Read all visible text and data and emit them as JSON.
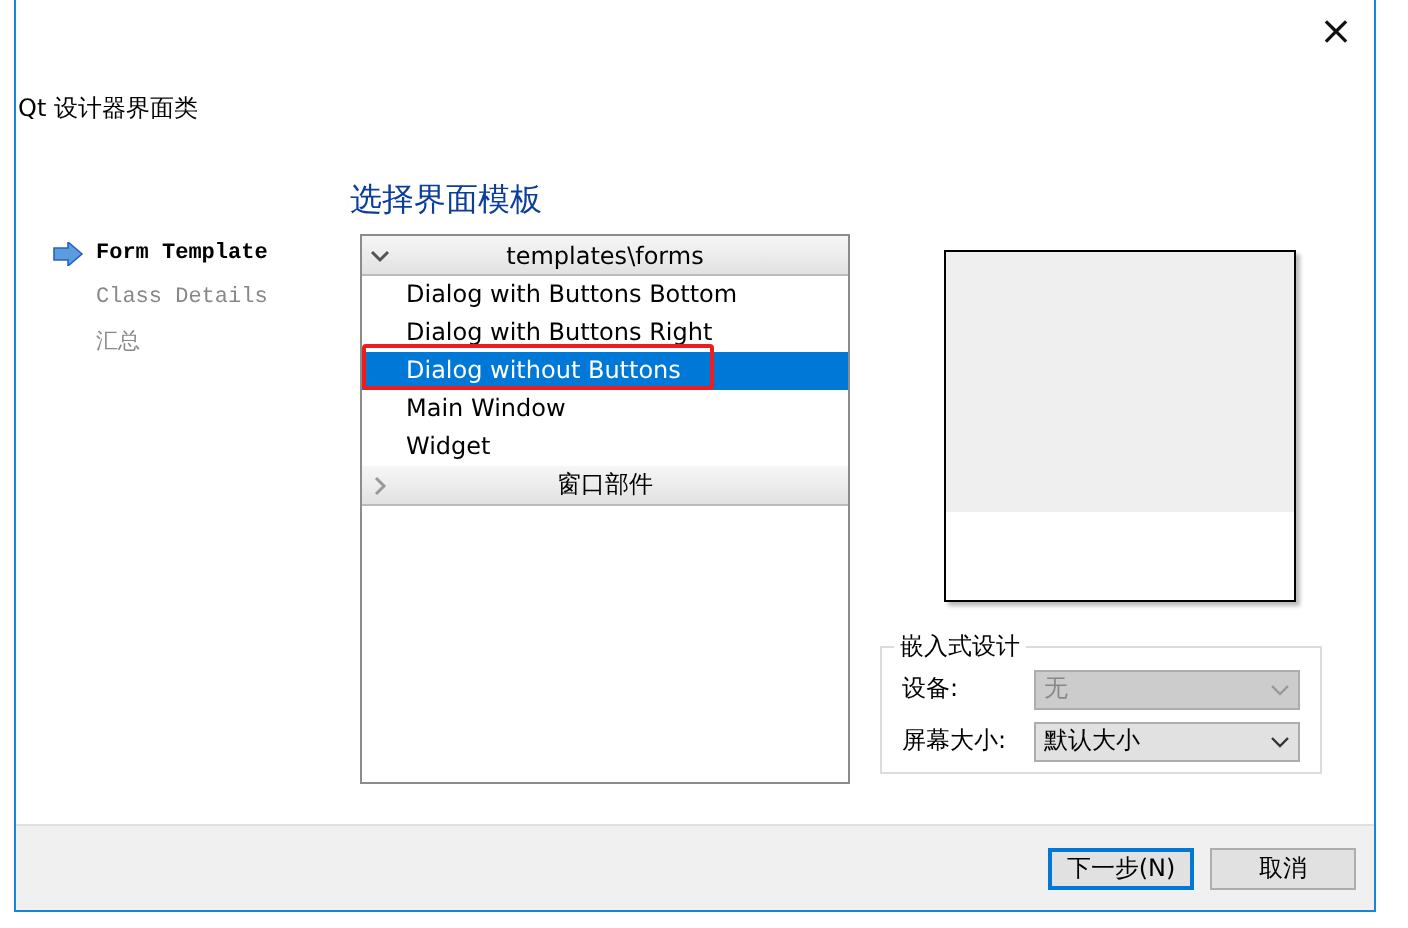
{
  "window": {
    "title": "Qt 设计器界面类",
    "close": "×"
  },
  "steps": [
    {
      "label": "Form Template",
      "selected": true
    },
    {
      "label": "Class Details",
      "selected": false
    },
    {
      "label": "汇总",
      "selected": false
    }
  ],
  "page_title": "选择界面模板",
  "template_tree": {
    "groups": [
      {
        "label": "templates\\forms",
        "expanded": true,
        "items": [
          {
            "label": "Dialog with Buttons Bottom",
            "selected": false,
            "highlighted": false
          },
          {
            "label": "Dialog with Buttons Right",
            "selected": false,
            "highlighted": false
          },
          {
            "label": "Dialog without Buttons",
            "selected": true,
            "highlighted": true
          },
          {
            "label": "Main Window",
            "selected": false,
            "highlighted": false
          },
          {
            "label": "Widget",
            "selected": false,
            "highlighted": false
          }
        ]
      },
      {
        "label": "窗口部件",
        "expanded": false
      }
    ]
  },
  "embedded_design": {
    "title": "嵌入式设计",
    "fields": [
      {
        "label": "设备:",
        "value": "无",
        "disabled": true
      },
      {
        "label": "屏幕大小:",
        "value": "默认大小",
        "disabled": false
      }
    ]
  },
  "buttons": [
    {
      "label": "下一步(N)",
      "default": true
    },
    {
      "label": "取消",
      "default": false
    }
  ]
}
